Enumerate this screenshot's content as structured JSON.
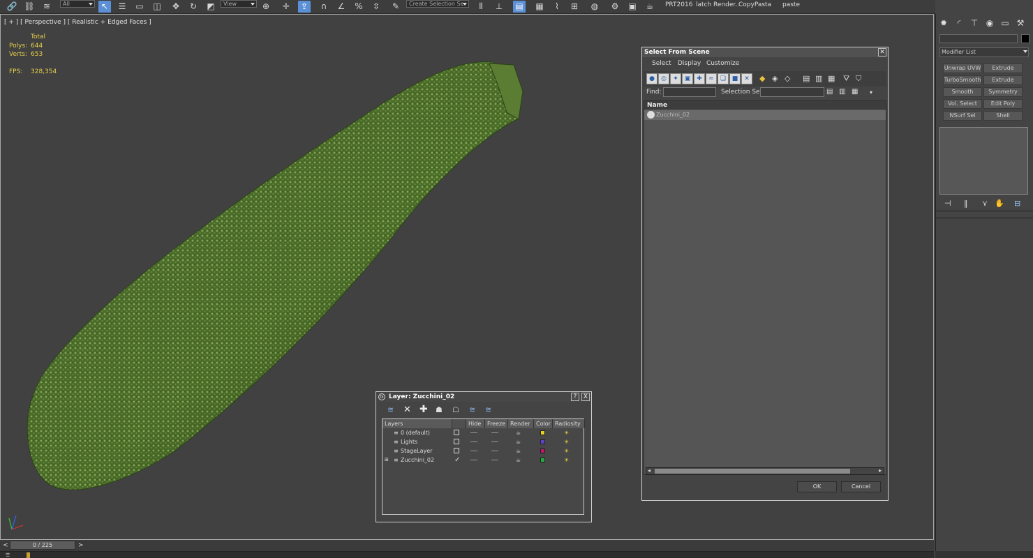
{
  "toolbar": {
    "selection_filter": "All",
    "reference_coord": "View",
    "named_selection_placeholder": "Create Selection Se",
    "labels": [
      "PRT2016",
      "latch Render...",
      "CopyPasta",
      "paste"
    ]
  },
  "viewport": {
    "label": "[ + ] [ Perspective ] [ Realistic + Edged Faces ]",
    "stats": {
      "total_label": "Total",
      "polys_label": "Polys:",
      "polys_value": "644",
      "verts_label": "Verts:",
      "verts_value": "653",
      "fps_label": "FPS:",
      "fps_value": "328,354"
    }
  },
  "command_panel": {
    "modifier_list": "Modifier List",
    "buttons": [
      "Unwrap UVW",
      "Extrude",
      "TurboSmooth",
      "Extrude",
      "Smooth",
      "Symmetry",
      "Vol. Select",
      "Edit Poly",
      "NSurf Sel",
      "Shell"
    ]
  },
  "select_from_scene": {
    "title": "Select From Scene",
    "menu": [
      "Select",
      "Display",
      "Customize"
    ],
    "find_label": "Find:",
    "selection_set_label": "Selection Set:",
    "column_name": "Name",
    "items": [
      "Zucchini_02"
    ],
    "ok": "OK",
    "cancel": "Cancel"
  },
  "layer_dialog": {
    "title": "Layer: Zucchini_02",
    "help": "?",
    "close": "X",
    "columns": [
      "Layers",
      "Hide",
      "Freeze",
      "Render",
      "Color",
      "Radiosity"
    ],
    "rows": [
      {
        "name": "0 (default)",
        "color": "#e8d020",
        "current": false
      },
      {
        "name": "Lights",
        "color": "#6040d0",
        "current": false
      },
      {
        "name": "StageLayer",
        "color": "#c01870",
        "current": false
      },
      {
        "name": "Zucchini_02",
        "color": "#20b040",
        "current": true
      }
    ]
  },
  "timeline": {
    "frame": "0 / 225",
    "prev": "<",
    "next": ">"
  },
  "colors": {
    "accent": "#5b8fd6",
    "stats": "#e8d04a",
    "zucchini": "#4b6f2a"
  }
}
